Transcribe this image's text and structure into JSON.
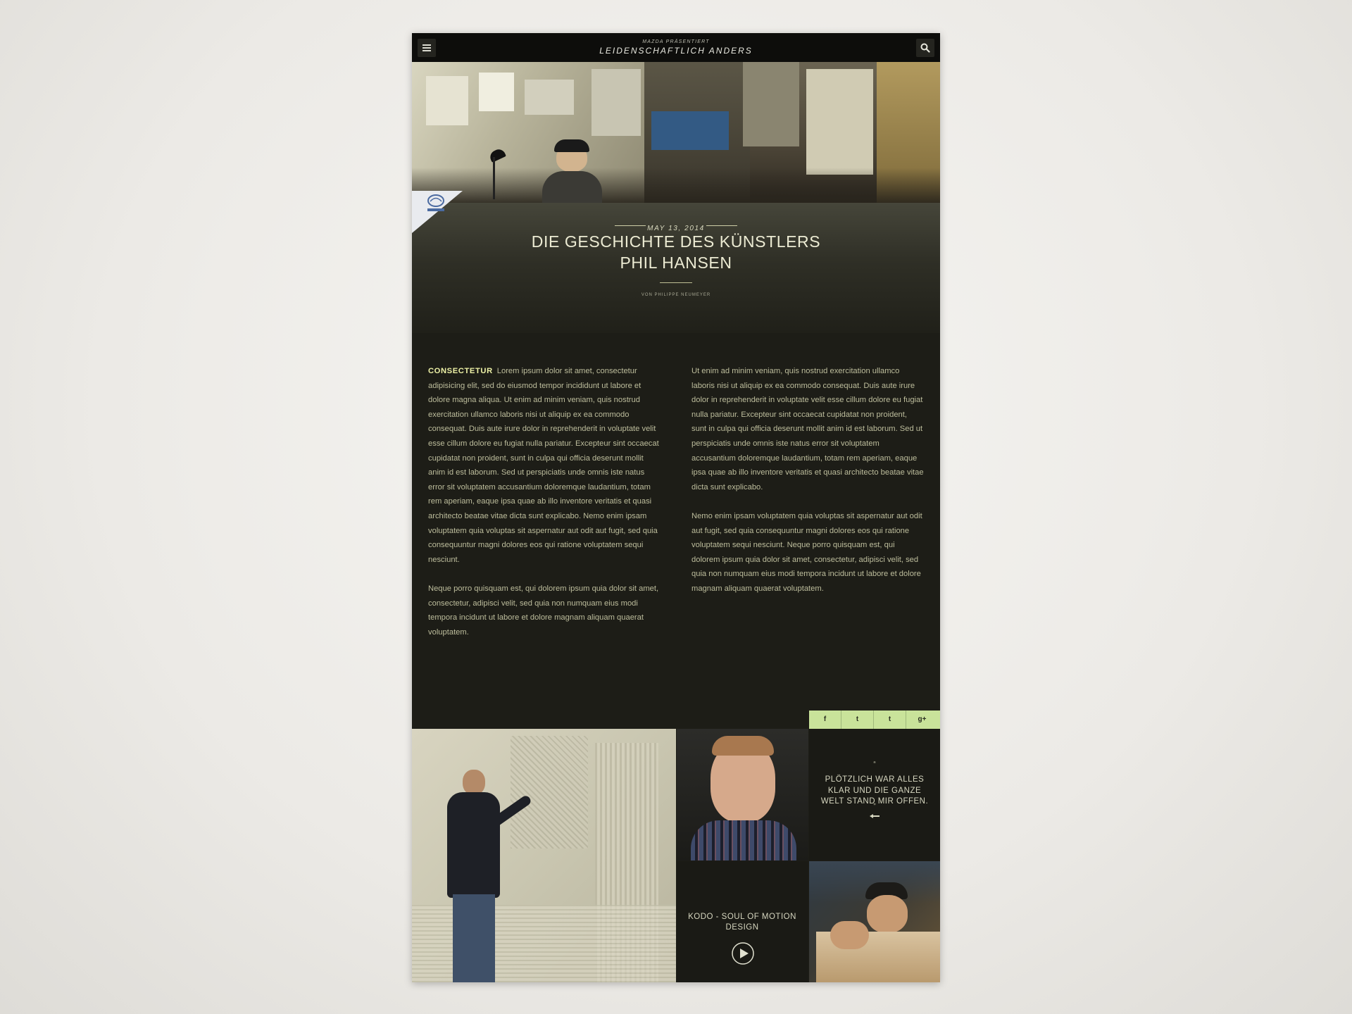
{
  "header": {
    "kicker": "MAZDA PRÄSENTIERT",
    "title": "LEIDENSCHAFTLICH ANDERS",
    "menu_icon": "hamburger-icon",
    "search_icon": "search-icon"
  },
  "hero": {
    "image": "artist-studio-photo",
    "logo": "mazda-logo"
  },
  "article": {
    "date": "MAY 13, 2014",
    "title_line1": "DIE GESCHICHTE DES KÜNSTLERS",
    "title_line2": "PHIL HANSEN",
    "byline": "VON PHILIPPE NEUMEYER",
    "lead": "CONSECTETUR",
    "left_p1": "Lorem ipsum dolor sit amet, consectetur adipisicing elit, sed do eiusmod tempor incididunt ut labore et dolore magna aliqua. Ut enim ad minim veniam, quis nostrud exercitation ullamco laboris nisi ut aliquip ex ea commodo consequat. Duis aute irure dolor in reprehenderit in voluptate velit esse cillum dolore eu fugiat nulla pariatur. Excepteur sint occaecat cupidatat non proident, sunt in culpa qui officia deserunt mollit anim id est laborum. Sed ut perspiciatis unde omnis iste natus error sit voluptatem accusantium doloremque laudantium, totam rem aperiam, eaque ipsa quae ab illo inventore veritatis et quasi architecto beatae vitae dicta sunt explicabo. Nemo enim ipsam voluptatem quia voluptas sit aspernatur aut odit aut fugit, sed quia consequuntur magni dolores eos qui ratione voluptatem sequi nesciunt.",
    "left_p2": "Neque porro quisquam est, qui dolorem ipsum quia dolor sit amet, consectetur, adipisci velit, sed quia non numquam eius modi tempora incidunt ut labore et dolore magnam aliquam quaerat voluptatem.",
    "right_p1": "Ut enim ad minim veniam, quis nostrud exercitation ullamco laboris nisi ut aliquip ex ea commodo consequat. Duis aute irure dolor in reprehenderit in voluptate velit esse cillum dolore eu fugiat nulla pariatur. Excepteur sint occaecat cupidatat non proident, sunt in culpa qui officia deserunt mollit anim id est laborum. Sed ut perspiciatis unde omnis iste natus error sit voluptatem accusantium doloremque laudantium, totam rem aperiam, eaque ipsa quae ab illo inventore veritatis et quasi architecto beatae vitae dicta sunt explicabo.",
    "right_p2": "Nemo enim ipsam voluptatem quia voluptas sit aspernatur aut odit aut fugit, sed quia consequuntur magni dolores eos qui ratione voluptatem sequi nesciunt. Neque porro quisquam est, qui dolorem ipsum quia dolor sit amet, consectetur, adipisci velit, sed quia non numquam eius modi tempora incidunt ut labore et dolore magnam aliquam quaerat voluptatem."
  },
  "social": {
    "facebook": "f",
    "twitter": "t",
    "tumblr": "t",
    "googleplus": "g+"
  },
  "tiles": {
    "quote": {
      "open_mark": "“",
      "text": "PLÖTZLICH WAR ALLES KLAR UND DIE GANZE WELT STAND MIR OFFEN.",
      "close_mark": "”",
      "arrow_icon": "arrow-left-icon"
    },
    "video": {
      "title": "KODO - SOUL OF MOTION DESIGN",
      "play_icon": "play-icon"
    }
  },
  "colors": {
    "page_bg": "#1d1d17",
    "accent_green": "#c9e39a",
    "lead_text": "#edf1a6",
    "body_text": "#bdbd9c"
  }
}
